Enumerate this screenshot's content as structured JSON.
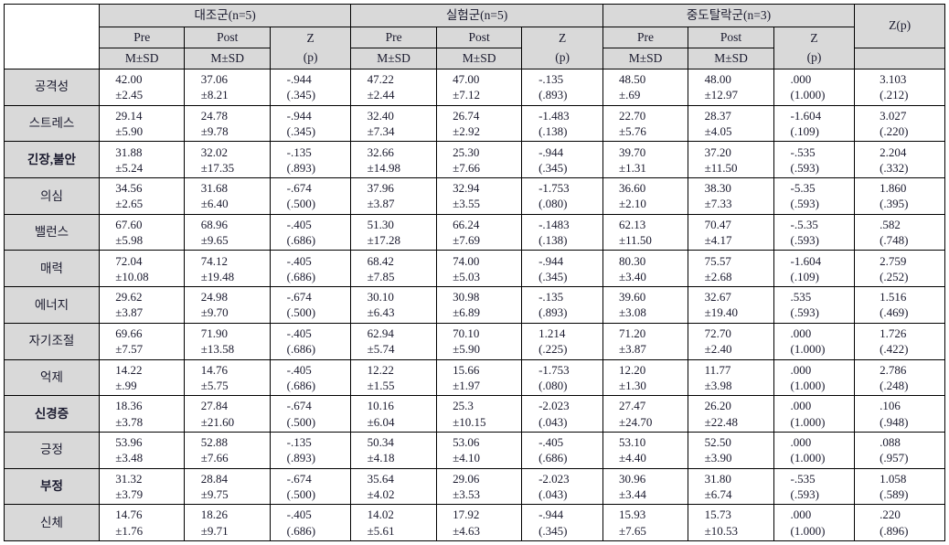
{
  "table": {
    "corner_label": "",
    "groups": [
      {
        "name": "대조군(n=5)"
      },
      {
        "name": "실험군(n=5)"
      },
      {
        "name": "중도탈락군(n=3)"
      }
    ],
    "subheaders": {
      "pre": "Pre",
      "post": "Post",
      "msd": "M±SD",
      "z": "Z",
      "p": "(p)"
    },
    "final_col_header": "Z(p)",
    "rows": [
      {
        "label": "공격성",
        "bold": false,
        "c_pre_m": "42.00",
        "c_pre_sd": "±2.45",
        "c_post_m": "37.06",
        "c_post_sd": "±8.21",
        "c_z": "-.944",
        "c_p": "(.345)",
        "e_pre_m": "47.22",
        "e_pre_sd": "±2.44",
        "e_post_m": "47.00",
        "e_post_sd": "±7.12",
        "e_z": "-.135",
        "e_p": "(.893)",
        "d_pre_m": "48.50",
        "d_pre_sd": "±.69",
        "d_post_m": "48.00",
        "d_post_sd": "±12.97",
        "d_z": ".000",
        "d_p": "(1.000)",
        "f_z": "3.103",
        "f_p": "(.212)"
      },
      {
        "label": "스트레스",
        "bold": false,
        "c_pre_m": "29.14",
        "c_pre_sd": "±5.90",
        "c_post_m": "24.78",
        "c_post_sd": "±9.78",
        "c_z": "-.944",
        "c_p": "(.345)",
        "e_pre_m": "32.40",
        "e_pre_sd": "±7.34",
        "e_post_m": "26.74",
        "e_post_sd": "±2.92",
        "e_z": "-1.483",
        "e_p": "(.138)",
        "d_pre_m": "22.70",
        "d_pre_sd": "±5.76",
        "d_post_m": "28.37",
        "d_post_sd": "±4.05",
        "d_z": "-1.604",
        "d_p": "(.109)",
        "f_z": "3.027",
        "f_p": "(.220)"
      },
      {
        "label": "긴장,불안",
        "bold": true,
        "c_pre_m": "31.88",
        "c_pre_sd": "±5.24",
        "c_post_m": "32.02",
        "c_post_sd": "±17.35",
        "c_z": "-.135",
        "c_p": "(.893)",
        "e_pre_m": "32.66",
        "e_pre_sd": "±14.98",
        "e_post_m": "25.30",
        "e_post_sd": "±7.66",
        "e_z": "-.944",
        "e_p": "(.345)",
        "d_pre_m": "39.70",
        "d_pre_sd": "±1.31",
        "d_post_m": "37.20",
        "d_post_sd": "±11.50",
        "d_z": "-.535",
        "d_p": "(.593)",
        "f_z": "2.204",
        "f_p": "(.332)"
      },
      {
        "label": "의심",
        "bold": false,
        "c_pre_m": "34.56",
        "c_pre_sd": "±2.65",
        "c_post_m": "31.68",
        "c_post_sd": "±6.40",
        "c_z": "-.674",
        "c_p": "(.500)",
        "e_pre_m": "37.96",
        "e_pre_sd": "±3.87",
        "e_post_m": "32.94",
        "e_post_sd": "±3.55",
        "e_z": "-1.753",
        "e_p": "(.080)",
        "d_pre_m": "36.60",
        "d_pre_sd": "±2.10",
        "d_post_m": "38.30",
        "d_post_sd": "±7.33",
        "d_z": "-5.35",
        "d_p": "(.593)",
        "f_z": "1.860",
        "f_p": "(.395)"
      },
      {
        "label": "밸런스",
        "bold": false,
        "c_pre_m": "67.60",
        "c_pre_sd": "±5.98",
        "c_post_m": "68.96",
        "c_post_sd": "±9.65",
        "c_z": "-.405",
        "c_p": "(.686)",
        "e_pre_m": "51.30",
        "e_pre_sd": "±17.28",
        "e_post_m": "66.24",
        "e_post_sd": "±7.69",
        "e_z": "-.1483",
        "e_p": "(.138)",
        "d_pre_m": "62.13",
        "d_pre_sd": "±11.50",
        "d_post_m": "70.47",
        "d_post_sd": "±4.17",
        "d_z": "-.5.35",
        "d_p": "(.593)",
        "f_z": ".582",
        "f_p": "(.748)"
      },
      {
        "label": "매력",
        "bold": false,
        "c_pre_m": "72.04",
        "c_pre_sd": "±10.08",
        "c_post_m": "74.12",
        "c_post_sd": "±19.48",
        "c_z": "-.405",
        "c_p": "(.686)",
        "e_pre_m": "68.42",
        "e_pre_sd": "±7.85",
        "e_post_m": "74.00",
        "e_post_sd": "±5.03",
        "e_z": "-.944",
        "e_p": "(.345)",
        "d_pre_m": "80.30",
        "d_pre_sd": "±3.40",
        "d_post_m": "75.57",
        "d_post_sd": "±2.68",
        "d_z": "-1.604",
        "d_p": "(.109)",
        "f_z": "2.759",
        "f_p": "(.252)"
      },
      {
        "label": "에너지",
        "bold": false,
        "c_pre_m": "29.62",
        "c_pre_sd": "±3.87",
        "c_post_m": "24.98",
        "c_post_sd": "±9.70",
        "c_z": "-.674",
        "c_p": "(.500)",
        "e_pre_m": "30.10",
        "e_pre_sd": "±6.43",
        "e_post_m": "30.98",
        "e_post_sd": "±6.89",
        "e_z": "-.135",
        "e_p": "(.893)",
        "d_pre_m": "39.60",
        "d_pre_sd": "±3.08",
        "d_post_m": "32.67",
        "d_post_sd": "±19.40",
        "d_z": ".535",
        "d_p": "(.593)",
        "f_z": "1.516",
        "f_p": "(.469)"
      },
      {
        "label": "자기조절",
        "bold": false,
        "c_pre_m": "69.66",
        "c_pre_sd": "±7.57",
        "c_post_m": "71.90",
        "c_post_sd": "±13.58",
        "c_z": "-.405",
        "c_p": "(.686)",
        "e_pre_m": "62.94",
        "e_pre_sd": "±5.74",
        "e_post_m": "70.10",
        "e_post_sd": "±5.90",
        "e_z": "1.214",
        "e_p": "(.225)",
        "d_pre_m": "71.20",
        "d_pre_sd": "±3.87",
        "d_post_m": "72.70",
        "d_post_sd": "±2.40",
        "d_z": ".000",
        "d_p": "(1.000)",
        "f_z": "1.726",
        "f_p": "(.422)"
      },
      {
        "label": "억제",
        "bold": false,
        "c_pre_m": "14.22",
        "c_pre_sd": "±.99",
        "c_post_m": "14.76",
        "c_post_sd": "±5.75",
        "c_z": "-.405",
        "c_p": "(.686)",
        "e_pre_m": "12.22",
        "e_pre_sd": "±1.55",
        "e_post_m": "15.66",
        "e_post_sd": "±1.97",
        "e_z": "-1.753",
        "e_p": "(.080)",
        "d_pre_m": "12.20",
        "d_pre_sd": "±1.30",
        "d_post_m": "11.77",
        "d_post_sd": "±3.98",
        "d_z": ".000",
        "d_p": "(1.000)",
        "f_z": "2.786",
        "f_p": "(.248)"
      },
      {
        "label": "신경증",
        "bold": true,
        "c_pre_m": "18.36",
        "c_pre_sd": "±3.78",
        "c_post_m": "27.84",
        "c_post_sd": "±21.60",
        "c_z": "-.674",
        "c_p": "(.500)",
        "e_pre_m": "10.16",
        "e_pre_sd": "±6.04",
        "e_post_m": "25.3",
        "e_post_sd": "±10.15",
        "e_z": "-2.023",
        "e_p": "(.043)",
        "d_pre_m": "27.47",
        "d_pre_sd": "±24.70",
        "d_post_m": "26.20",
        "d_post_sd": "±22.48",
        "d_z": ".000",
        "d_p": "(1.000)",
        "f_z": ".106",
        "f_p": "(.948)"
      },
      {
        "label": "긍정",
        "bold": false,
        "c_pre_m": "53.96",
        "c_pre_sd": "±3.48",
        "c_post_m": "52.88",
        "c_post_sd": "±7.66",
        "c_z": "-.135",
        "c_p": "(.893)",
        "e_pre_m": "50.34",
        "e_pre_sd": "±4.18",
        "e_post_m": "53.06",
        "e_post_sd": "±4.10",
        "e_z": "-.405",
        "e_p": "(.686)",
        "d_pre_m": "53.10",
        "d_pre_sd": "±4.40",
        "d_post_m": "52.50",
        "d_post_sd": "±3.90",
        "d_z": ".000",
        "d_p": "(1.000)",
        "f_z": ".088",
        "f_p": "(.957)"
      },
      {
        "label": "부정",
        "bold": true,
        "c_pre_m": "31.32",
        "c_pre_sd": "±3.79",
        "c_post_m": "28.84",
        "c_post_sd": "±9.75",
        "c_z": "-.674",
        "c_p": "(.500)",
        "e_pre_m": "35.64",
        "e_pre_sd": "±4.02",
        "e_post_m": "29.06",
        "e_post_sd": "±3.53",
        "e_z": "-2.023",
        "e_p": "(.043)",
        "d_pre_m": "30.96",
        "d_pre_sd": "±3.44",
        "d_post_m": "31.80",
        "d_post_sd": "±6.74",
        "d_z": "-.535",
        "d_p": "(.593)",
        "f_z": "1.058",
        "f_p": "(.589)"
      },
      {
        "label": "신체",
        "bold": false,
        "c_pre_m": "14.76",
        "c_pre_sd": "±1.76",
        "c_post_m": "18.26",
        "c_post_sd": "±9.71",
        "c_z": "-.405",
        "c_p": "(.686)",
        "e_pre_m": "14.02",
        "e_pre_sd": "±5.61",
        "e_post_m": "17.92",
        "e_post_sd": "±4.63",
        "e_z": "-.944",
        "e_p": "(.345)",
        "d_pre_m": "15.93",
        "d_pre_sd": "±7.65",
        "d_post_m": "15.73",
        "d_post_sd": "±10.53",
        "d_z": ".000",
        "d_p": "(1.000)",
        "f_z": ".220",
        "f_p": "(.896)"
      }
    ]
  }
}
